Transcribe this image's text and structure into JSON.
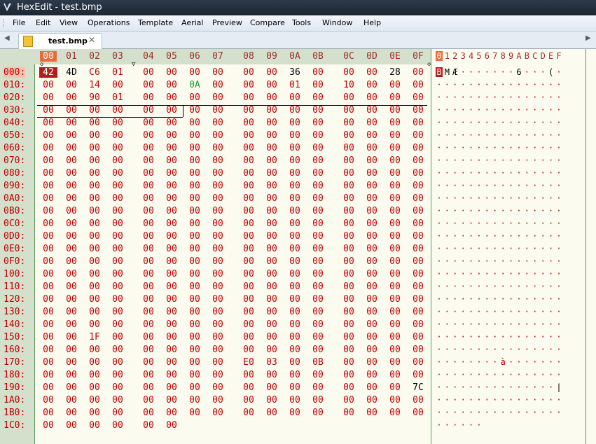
{
  "window": {
    "title": "HexEdit - test.bmp"
  },
  "menu": [
    "File",
    "Edit",
    "View",
    "Operations",
    "Template",
    "Aerial",
    "Preview",
    "Compare",
    "Tools",
    "Window",
    "Help"
  ],
  "tab": {
    "label": "test.bmp"
  },
  "hex_header": [
    "00",
    "01",
    "02",
    "03",
    "04",
    "05",
    "06",
    "07",
    "08",
    "09",
    "0A",
    "0B",
    "0C",
    "0D",
    "0E",
    "0F"
  ],
  "ascii_header": [
    "0",
    "1",
    "2",
    "3",
    "4",
    "5",
    "6",
    "7",
    "8",
    "9",
    "A",
    "B",
    "C",
    "D",
    "E",
    "F"
  ],
  "rows": [
    {
      "offset": "000:",
      "bytes": [
        "42",
        "4D",
        "C6",
        "01",
        "00",
        "00",
        "00",
        "00",
        "00",
        "00",
        "36",
        "00",
        "00",
        "00",
        "28",
        "00"
      ],
      "ascii": "BMÆ·······6···(·"
    },
    {
      "offset": "010:",
      "bytes": [
        "00",
        "00",
        "14",
        "00",
        "00",
        "00",
        "0A",
        "00",
        "00",
        "00",
        "01",
        "00",
        "10",
        "00",
        "00",
        "00"
      ],
      "ascii": "················"
    },
    {
      "offset": "020:",
      "bytes": [
        "00",
        "00",
        "90",
        "01",
        "00",
        "00",
        "00",
        "00",
        "00",
        "00",
        "00",
        "00",
        "00",
        "00",
        "00",
        "00"
      ],
      "ascii": "················"
    },
    {
      "offset": "030:",
      "bytes": [
        "00",
        "00",
        "00",
        "00",
        "00",
        "00",
        "00",
        "00",
        "00",
        "00",
        "00",
        "00",
        "00",
        "00",
        "00",
        "00"
      ],
      "ascii": "················"
    },
    {
      "offset": "040:",
      "bytes": [
        "00",
        "00",
        "00",
        "00",
        "00",
        "00",
        "00",
        "00",
        "00",
        "00",
        "00",
        "00",
        "00",
        "00",
        "00",
        "00"
      ],
      "ascii": "················"
    },
    {
      "offset": "050:",
      "bytes": [
        "00",
        "00",
        "00",
        "00",
        "00",
        "00",
        "00",
        "00",
        "00",
        "00",
        "00",
        "00",
        "00",
        "00",
        "00",
        "00"
      ],
      "ascii": "················"
    },
    {
      "offset": "060:",
      "bytes": [
        "00",
        "00",
        "00",
        "00",
        "00",
        "00",
        "00",
        "00",
        "00",
        "00",
        "00",
        "00",
        "00",
        "00",
        "00",
        "00"
      ],
      "ascii": "················"
    },
    {
      "offset": "070:",
      "bytes": [
        "00",
        "00",
        "00",
        "00",
        "00",
        "00",
        "00",
        "00",
        "00",
        "00",
        "00",
        "00",
        "00",
        "00",
        "00",
        "00"
      ],
      "ascii": "················"
    },
    {
      "offset": "080:",
      "bytes": [
        "00",
        "00",
        "00",
        "00",
        "00",
        "00",
        "00",
        "00",
        "00",
        "00",
        "00",
        "00",
        "00",
        "00",
        "00",
        "00"
      ],
      "ascii": "················"
    },
    {
      "offset": "090:",
      "bytes": [
        "00",
        "00",
        "00",
        "00",
        "00",
        "00",
        "00",
        "00",
        "00",
        "00",
        "00",
        "00",
        "00",
        "00",
        "00",
        "00"
      ],
      "ascii": "················"
    },
    {
      "offset": "0A0:",
      "bytes": [
        "00",
        "00",
        "00",
        "00",
        "00",
        "00",
        "00",
        "00",
        "00",
        "00",
        "00",
        "00",
        "00",
        "00",
        "00",
        "00"
      ],
      "ascii": "················"
    },
    {
      "offset": "0B0:",
      "bytes": [
        "00",
        "00",
        "00",
        "00",
        "00",
        "00",
        "00",
        "00",
        "00",
        "00",
        "00",
        "00",
        "00",
        "00",
        "00",
        "00"
      ],
      "ascii": "················"
    },
    {
      "offset": "0C0:",
      "bytes": [
        "00",
        "00",
        "00",
        "00",
        "00",
        "00",
        "00",
        "00",
        "00",
        "00",
        "00",
        "00",
        "00",
        "00",
        "00",
        "00"
      ],
      "ascii": "················"
    },
    {
      "offset": "0D0:",
      "bytes": [
        "00",
        "00",
        "00",
        "00",
        "00",
        "00",
        "00",
        "00",
        "00",
        "00",
        "00",
        "00",
        "00",
        "00",
        "00",
        "00"
      ],
      "ascii": "················"
    },
    {
      "offset": "0E0:",
      "bytes": [
        "00",
        "00",
        "00",
        "00",
        "00",
        "00",
        "00",
        "00",
        "00",
        "00",
        "00",
        "00",
        "00",
        "00",
        "00",
        "00"
      ],
      "ascii": "················"
    },
    {
      "offset": "0F0:",
      "bytes": [
        "00",
        "00",
        "00",
        "00",
        "00",
        "00",
        "00",
        "00",
        "00",
        "00",
        "00",
        "00",
        "00",
        "00",
        "00",
        "00"
      ],
      "ascii": "················"
    },
    {
      "offset": "100:",
      "bytes": [
        "00",
        "00",
        "00",
        "00",
        "00",
        "00",
        "00",
        "00",
        "00",
        "00",
        "00",
        "00",
        "00",
        "00",
        "00",
        "00"
      ],
      "ascii": "················"
    },
    {
      "offset": "110:",
      "bytes": [
        "00",
        "00",
        "00",
        "00",
        "00",
        "00",
        "00",
        "00",
        "00",
        "00",
        "00",
        "00",
        "00",
        "00",
        "00",
        "00"
      ],
      "ascii": "················"
    },
    {
      "offset": "120:",
      "bytes": [
        "00",
        "00",
        "00",
        "00",
        "00",
        "00",
        "00",
        "00",
        "00",
        "00",
        "00",
        "00",
        "00",
        "00",
        "00",
        "00"
      ],
      "ascii": "················"
    },
    {
      "offset": "130:",
      "bytes": [
        "00",
        "00",
        "00",
        "00",
        "00",
        "00",
        "00",
        "00",
        "00",
        "00",
        "00",
        "00",
        "00",
        "00",
        "00",
        "00"
      ],
      "ascii": "················"
    },
    {
      "offset": "140:",
      "bytes": [
        "00",
        "00",
        "00",
        "00",
        "00",
        "00",
        "00",
        "00",
        "00",
        "00",
        "00",
        "00",
        "00",
        "00",
        "00",
        "00"
      ],
      "ascii": "················"
    },
    {
      "offset": "150:",
      "bytes": [
        "00",
        "00",
        "1F",
        "00",
        "00",
        "00",
        "00",
        "00",
        "00",
        "00",
        "00",
        "00",
        "00",
        "00",
        "00",
        "00"
      ],
      "ascii": "················"
    },
    {
      "offset": "160:",
      "bytes": [
        "00",
        "00",
        "00",
        "00",
        "00",
        "00",
        "00",
        "00",
        "00",
        "00",
        "00",
        "00",
        "00",
        "00",
        "00",
        "00"
      ],
      "ascii": "················"
    },
    {
      "offset": "170:",
      "bytes": [
        "00",
        "00",
        "00",
        "00",
        "00",
        "00",
        "00",
        "00",
        "E0",
        "03",
        "00",
        "0B",
        "00",
        "00",
        "00",
        "00"
      ],
      "ascii": "········à·······"
    },
    {
      "offset": "180:",
      "bytes": [
        "00",
        "00",
        "00",
        "00",
        "00",
        "00",
        "00",
        "00",
        "00",
        "00",
        "00",
        "00",
        "00",
        "00",
        "00",
        "00"
      ],
      "ascii": "················"
    },
    {
      "offset": "190:",
      "bytes": [
        "00",
        "00",
        "00",
        "00",
        "00",
        "00",
        "00",
        "00",
        "00",
        "00",
        "00",
        "00",
        "00",
        "00",
        "00",
        "7C"
      ],
      "ascii": "···············|"
    },
    {
      "offset": "1A0:",
      "bytes": [
        "00",
        "00",
        "00",
        "00",
        "00",
        "00",
        "00",
        "00",
        "00",
        "00",
        "00",
        "00",
        "00",
        "00",
        "00",
        "00"
      ],
      "ascii": "················"
    },
    {
      "offset": "1B0:",
      "bytes": [
        "00",
        "00",
        "00",
        "00",
        "00",
        "00",
        "00",
        "00",
        "00",
        "00",
        "00",
        "00",
        "00",
        "00",
        "00",
        "00"
      ],
      "ascii": "················"
    },
    {
      "offset": "1C0:",
      "bytes": [
        "00",
        "00",
        "00",
        "00",
        "00",
        "00"
      ],
      "ascii": "······"
    }
  ],
  "colors": {
    "offset_bg": "#d4e0cc",
    "cursor": "#b31d1d",
    "text_red": "#c00000",
    "green": "#20a020"
  }
}
